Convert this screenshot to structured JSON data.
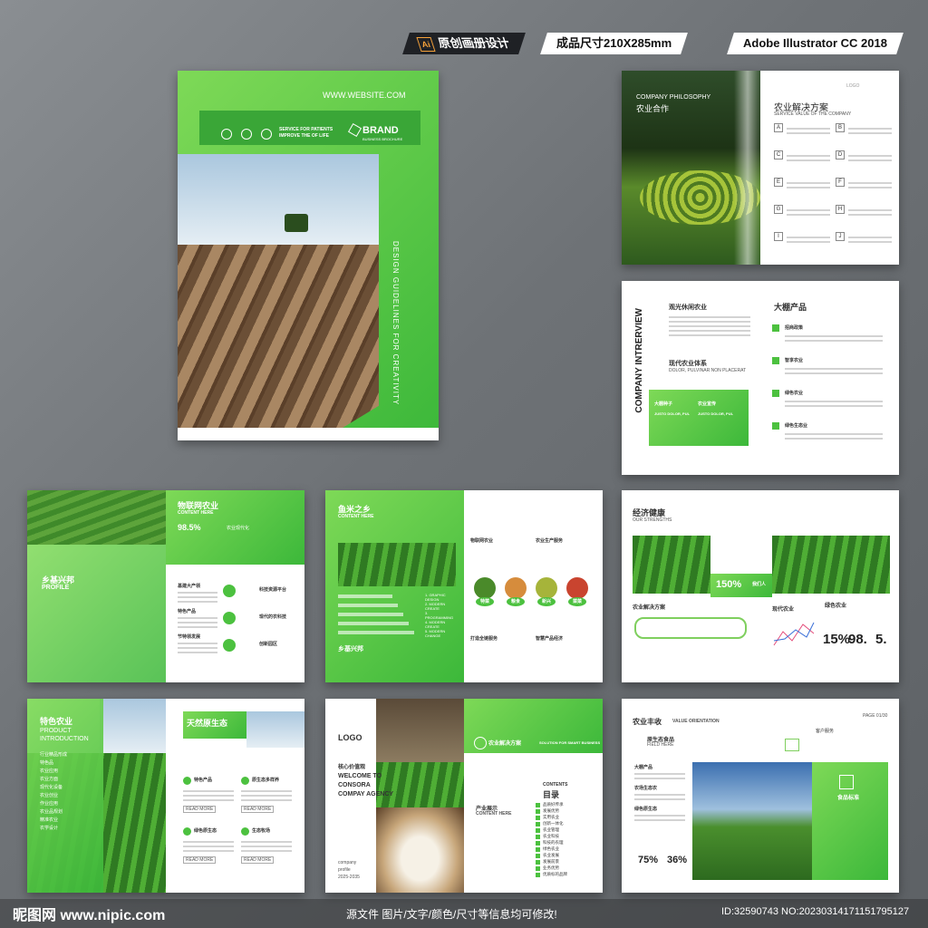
{
  "header": {
    "tag1": "原创画册设计",
    "tag1_icon": "Ai",
    "tag2": "成品尺寸210X285mm",
    "tag3": "Adobe Illustrator CC 2018"
  },
  "cover": {
    "website": "WWW.WEBSITE.COM",
    "brand": "BRAND",
    "brand_sub": "BUSINESS BROCHURE",
    "service_line1": "SERVICE FOR PATIENTS",
    "service_line2": "IMPROVE THE OF LIFE",
    "vertical_text": "DESIGN GUIDELINES FOR CREATIVITY"
  },
  "spread1": {
    "en_title": "COMPANY PHILOSOPHY",
    "cn_title": "农业合作",
    "logo": "LOGO",
    "right_title": "农业解决方案",
    "right_sub": "SERVICE VALUE OF THE COMPANY",
    "letters": [
      "A",
      "B",
      "C",
      "D",
      "E",
      "F",
      "G",
      "H",
      "I",
      "J"
    ]
  },
  "spread2": {
    "vertical": "COMPANY INTRERVIEW",
    "title1": "观光休闲农业",
    "title2": "现代农业体系",
    "sub2": "DOLOR, PULVINAR NON PLACERAT",
    "box_a": "大棚种子",
    "box_b": "农业宣传",
    "box_en_a": "JUSTO DOLOR, PUL",
    "box_en_b": "JUSTO DOLOR, PUL",
    "right_title": "大棚产品",
    "items": [
      "招商政策",
      "智享农业",
      "绿色农业",
      "绿色生态业"
    ]
  },
  "spread3": {
    "title": "物联网农业",
    "sub": "CONTENT HERE",
    "stat": "98.5%",
    "stat_label": "农业现代化",
    "left_title": "乡基兴邦",
    "left_en": "PROFILE",
    "list": [
      "基建大产领",
      "特色产品",
      "节特领发展"
    ],
    "right_list": [
      "科技资源平台",
      "现代的农科技",
      "创新园区"
    ]
  },
  "spread4": {
    "title": "鱼米之乡",
    "sub": "CONTENT HERE",
    "steps": [
      "GRAPHIC DESIGN",
      "MODERN CREATE",
      "PROGRAMMING",
      "MODERN CREATE",
      "MODERN CHANGE"
    ],
    "bottom_title": "乡基兴邦",
    "circles": [
      "特菜",
      "粮食",
      "新兴",
      "菜菜"
    ],
    "right_labels": [
      "物联网农业",
      "农业生产服务",
      "打造全链服务",
      "智慧产品经济"
    ]
  },
  "spread5": {
    "title": "经济健康",
    "sub": "OUR STRENGTHS",
    "badge": "150%",
    "badge_label": "我们人",
    "section": "农业解决方案",
    "section_right": "现代农业",
    "section_right2": "绿色农业",
    "stat1": "15%",
    "stat2": "98.",
    "stat3": "5."
  },
  "spread6": {
    "left_title": "特色农业",
    "left_en1": "PRODUCT",
    "left_en2": "INTRODUCTION",
    "list": [
      "行业精品形成",
      "特色品",
      "农业应用",
      "农业方面",
      "现代化设备",
      "农业创业",
      "作业应用",
      "农业品规划",
      "精准农业",
      "农学设计"
    ],
    "header_title": "天然原生态",
    "features": [
      "特色产品",
      "原生态多样养",
      "绿色原生态",
      "生态牧场"
    ],
    "more": "READ MORE"
  },
  "spread7": {
    "logo": "LOGO",
    "cn": "核心价值观",
    "welcome1": "WELCOME TO",
    "welcome2": "CONSORA",
    "welcome3": "COMPAY AGENCY",
    "footer1": "company",
    "footer2": "profile",
    "footer3": "2025-2035",
    "right_header": "农业解决方案",
    "right_header_en": "SOLUTION FOR SMART BUSINESS",
    "contents_en": "CONTENTS",
    "contents_cn": "目录",
    "side_title": "产业展示",
    "side_sub": "CONTENT HERE",
    "toc": [
      "品质好传承",
      "发展优势",
      "实用农业",
      "创新一体化",
      "农业管理",
      "农业科技",
      "科技的农理",
      "绿色农业",
      "农业发展",
      "发展前景",
      "业务优势",
      "优质标的品牌"
    ]
  },
  "spread8": {
    "title": "农业丰收",
    "title_en": "VALUE ORIENTATION",
    "page": "PAGE 01/30",
    "item1": "原生态食品",
    "item1_en": "FIELD HERE",
    "item2": "客户服务",
    "list": [
      "大棚产品",
      "农场生态农",
      "绿色原生态"
    ],
    "stat1": "75%",
    "stat2": "36%",
    "box_label": "食品标准"
  },
  "footer": {
    "left": "昵图网 www.nipic.com",
    "center": "源文件 图片/文字/颜色/尺寸等信息均可修改!",
    "right": "ID:32590743 NO:20230314171151795127"
  },
  "colors": {
    "accent": "#4cc13f",
    "dark": "#1f2125"
  }
}
